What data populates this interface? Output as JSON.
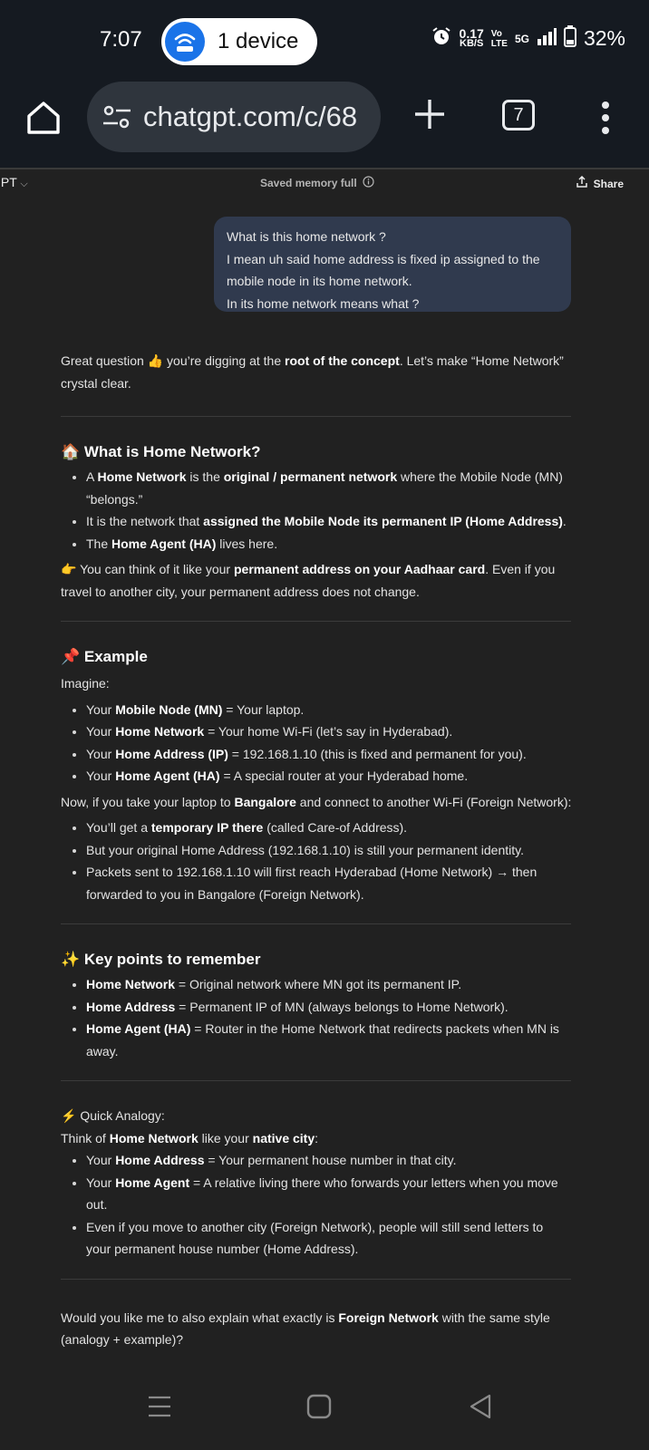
{
  "status": {
    "time": "7:07",
    "hotspot_label": "1 device",
    "net_speed_value": "0.17",
    "net_speed_unit": "KB/S",
    "volte": "Vo\nLTE",
    "network": "5G",
    "battery": "32%"
  },
  "browser": {
    "url": "chatgpt.com/c/68",
    "tab_count": "7"
  },
  "chat_header": {
    "model": "GPT",
    "memory_status": "Saved memory full",
    "share_label": "Share"
  },
  "user_message": {
    "lines": [
      "What is this home network ?",
      "I mean uh said home address is fixed ip assigned to the",
      "mobile node in its home network.",
      "In its home network means what ?"
    ]
  },
  "assistant": {
    "intro": {
      "a": "Great question 👍 you’re digging at the ",
      "b": "root of the concept",
      "c": ". Let’s make “Home Network” crystal clear."
    },
    "s1": {
      "heading": "🏠 What is Home Network?",
      "b1": {
        "a": "A ",
        "b": "Home Network",
        "c": " is the ",
        "d": "original / permanent network",
        "e": " where the Mobile Node (MN) “belongs.”"
      },
      "b2": {
        "a": "It is the network that ",
        "b": "assigned the Mobile Node its permanent IP (Home Address)",
        "c": "."
      },
      "b3": {
        "a": "The ",
        "b": "Home Agent (HA)",
        "c": " lives here."
      },
      "note": {
        "a": "👉 You can think of it like your ",
        "b": "permanent address on your Aadhaar card",
        "c": ". Even if you travel to another city, your permanent address does not change."
      }
    },
    "s2": {
      "heading": "📌 Example",
      "imagine": "Imagine:",
      "b1": {
        "a": "Your ",
        "b": "Mobile Node (MN)",
        "c": " = Your laptop."
      },
      "b2": {
        "a": "Your ",
        "b": "Home Network",
        "c": " = Your home Wi-Fi (let’s say in Hyderabad)."
      },
      "b3": {
        "a": "Your ",
        "b": "Home Address (IP)",
        "c": " = 192.168.1.10 (this is fixed and permanent for you)."
      },
      "b4": {
        "a": "Your ",
        "b": "Home Agent (HA)",
        "c": " = A special router at your Hyderabad home."
      },
      "now": {
        "a": "Now, if you take your laptop to ",
        "b": "Bangalore",
        "c": " and connect to another Wi-Fi (Foreign Network):"
      },
      "c1": {
        "a": "You’ll get a ",
        "b": "temporary IP there",
        "c": " (called Care-of Address)."
      },
      "c2": "But your original Home Address (192.168.1.10) is still your permanent identity.",
      "c3": "Packets sent to 192.168.1.10 will first reach Hyderabad (Home Network) → then forwarded to you in Bangalore (Foreign Network)."
    },
    "s3": {
      "heading": "✨ Key points to remember",
      "b1": {
        "b": "Home Network",
        "c": " = Original network where MN got its permanent IP."
      },
      "b2": {
        "b": "Home Address",
        "c": " = Permanent IP of MN (always belongs to Home Network)."
      },
      "b3": {
        "b": "Home Agent (HA)",
        "c": " = Router in the Home Network that redirects packets when MN is away."
      }
    },
    "s4": {
      "heading": "⚡ Quick Analogy:",
      "think": {
        "a": "Think of ",
        "b": "Home Network",
        "c": " like your ",
        "d": "native city",
        "e": ":"
      },
      "b1": {
        "a": "Your ",
        "b": "Home Address",
        "c": " = Your permanent house number in that city."
      },
      "b2": {
        "a": "Your ",
        "b": "Home Agent",
        "c": " = A relative living there who forwards your letters when you move out."
      },
      "b3": "Even if you move to another city (Foreign Network), people will still send letters to your permanent house number (Home Address)."
    },
    "outro": {
      "a": "Would you like me to also explain what exactly is ",
      "b": "Foreign Network",
      "c": " with the same style (analogy + example)?"
    }
  },
  "icons": {
    "hotspot": "wifi-router-icon",
    "alarm": "alarm-icon",
    "signal": "signal-bars-icon",
    "battery": "battery-icon",
    "home": "home-icon",
    "site_settings": "tune-icon",
    "new_tab": "plus-icon",
    "menu": "more-vert-icon",
    "share": "share-icon",
    "info": "info-icon",
    "nav_recents": "recents-icon",
    "nav_home": "nav-home-icon",
    "nav_back": "back-icon"
  },
  "colors": {
    "background": "#212121",
    "user_bubble": "#303a4e",
    "browser_chrome": "#151a21",
    "hotspot_blue": "#1a73e8"
  }
}
